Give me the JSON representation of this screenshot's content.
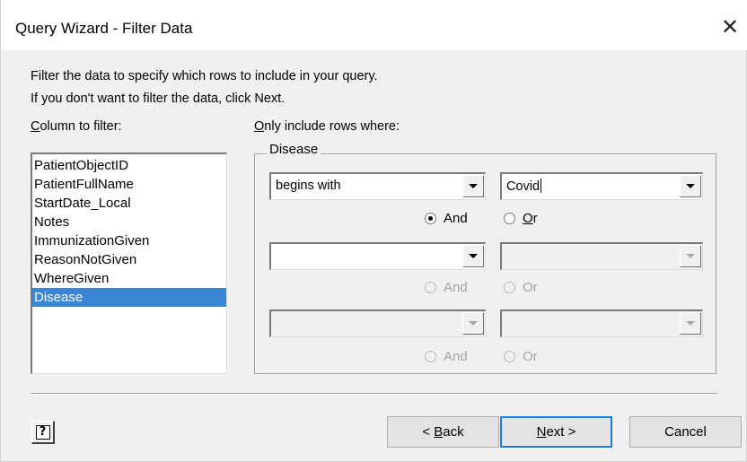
{
  "window": {
    "title": "Query Wizard - Filter Data",
    "close_glyph": "✕"
  },
  "instructions": {
    "line1": "Filter the data to specify which rows to include in your query.",
    "line2": "If you don't want to filter the data, click Next."
  },
  "column_filter": {
    "label_access_key": "C",
    "label_rest": "olumn to filter:",
    "items": [
      "PatientObjectID",
      "PatientFullName",
      "StartDate_Local",
      "Notes",
      "ImmunizationGiven",
      "ReasonNotGiven",
      "WhereGiven",
      "Disease"
    ],
    "selected": "Disease"
  },
  "criteria": {
    "header_access_key": "O",
    "header_rest": "nly include rows where:",
    "group_label": "Disease",
    "rows": [
      {
        "operator": "begins with",
        "value": "Covid",
        "enabled": true,
        "and_label": "And",
        "or_label": "Or",
        "or_access_key": "O",
        "or_rest": "r",
        "selected_conjunction": "And"
      },
      {
        "operator": "",
        "value": "",
        "enabled": true,
        "value_enabled": false,
        "and_label": "And",
        "or_label": "Or",
        "conjunction_enabled": false
      },
      {
        "operator": "",
        "value": "",
        "enabled": false,
        "and_label": "And",
        "or_label": "Or",
        "conjunction_enabled": false
      }
    ]
  },
  "buttons": {
    "help_glyph": "?",
    "back_prefix": "< ",
    "back_access_key": "B",
    "back_rest": "ack",
    "next_access_key": "N",
    "next_rest": "ext >",
    "cancel": "Cancel"
  },
  "icons": {
    "close": "close-icon",
    "dropdown": "chevron-down-icon",
    "help": "help-icon"
  },
  "colors": {
    "selection": "#3b86d4",
    "default_button_border": "#1c7ed6",
    "dialog_background": "#f0f0f0"
  }
}
